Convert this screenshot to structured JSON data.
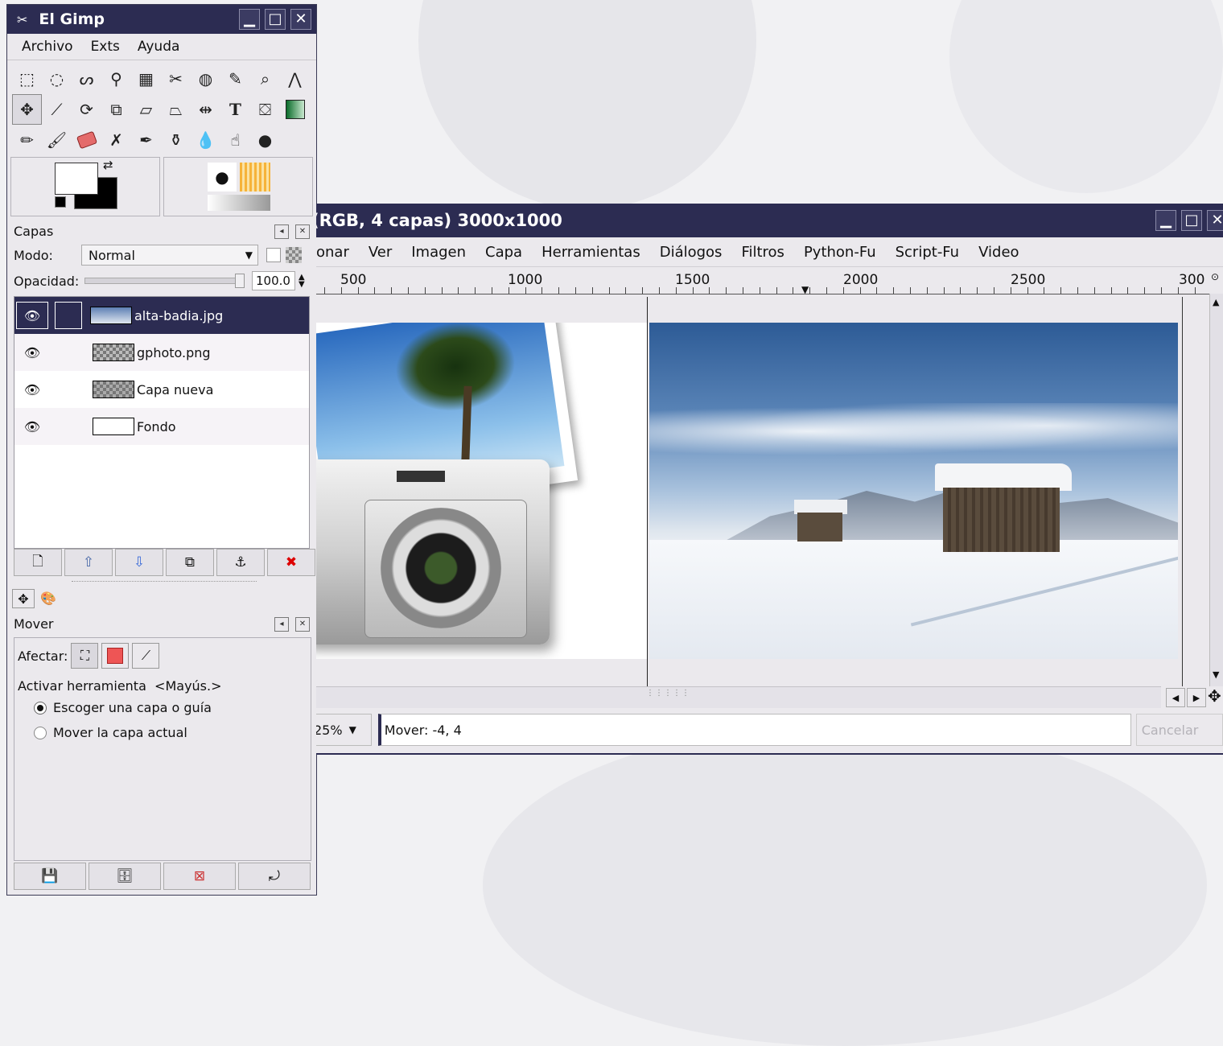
{
  "toolbox": {
    "title": "El Gimp",
    "menu": [
      "Archivo",
      "Exts",
      "Ayuda"
    ],
    "layers_panel": {
      "title": "Capas",
      "mode_label": "Modo:",
      "mode_value": "Normal",
      "opacity_label": "Opacidad:",
      "opacity_value": "100.0",
      "layers": [
        {
          "name": "alta-badia.jpg",
          "selected": true
        },
        {
          "name": "gphoto.png",
          "selected": false
        },
        {
          "name": "Capa nueva",
          "selected": false
        },
        {
          "name": "Fondo",
          "selected": false
        }
      ]
    },
    "tool_options": {
      "title": "Mover",
      "affect_label": "Afectar:",
      "toggle_label": "Activar herramienta  <Mayús.>",
      "options": [
        "Escoger una capa o guía",
        "Mover la capa actual"
      ],
      "selected_option": 0
    }
  },
  "image_window": {
    "title": "(RGB, 4 capas) 3000x1000",
    "menu": [
      "onar",
      "Ver",
      "Imagen",
      "Capa",
      "Herramientas",
      "Diálogos",
      "Filtros",
      "Python-Fu",
      "Script-Fu",
      "Video"
    ],
    "ruler_labels": [
      "500",
      "1000",
      "1500",
      "2000",
      "2500",
      "300"
    ],
    "zoom": "25%",
    "status": "Mover: -4, 4",
    "cancel_label": "Cancelar"
  },
  "colors": {
    "titlebar": "#2c2c52",
    "selection": "#2c2c52",
    "window_bg": "#ebe9ed"
  }
}
